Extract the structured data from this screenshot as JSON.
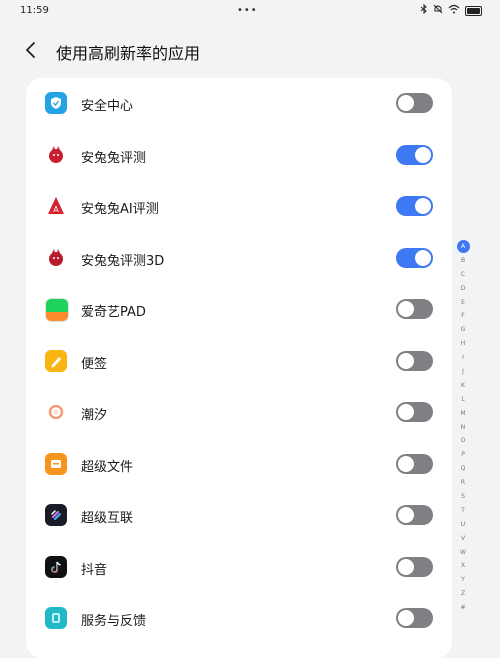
{
  "status_bar": {
    "time": "11:59",
    "dots": "•••"
  },
  "header": {
    "title": "使用高刷新率的应用"
  },
  "colors": {
    "accent": "#3f78f3",
    "toggle_off": "#7f8084",
    "card": "#ffffff",
    "background": "#f2f3f5"
  },
  "apps": [
    {
      "label": "安全中心",
      "icon": "security-center-icon",
      "enabled": false
    },
    {
      "label": "安兔兔评测",
      "icon": "antutu-icon",
      "enabled": true
    },
    {
      "label": "安兔兔AI评测",
      "icon": "antutu-ai-icon",
      "enabled": true
    },
    {
      "label": "安兔兔评测3D",
      "icon": "antutu-3d-icon",
      "enabled": true
    },
    {
      "label": "爱奇艺PAD",
      "icon": "iqiyi-icon",
      "enabled": false
    },
    {
      "label": "便签",
      "icon": "notes-icon",
      "enabled": false
    },
    {
      "label": "潮汐",
      "icon": "tide-icon",
      "enabled": false
    },
    {
      "label": "超级文件",
      "icon": "super-files-icon",
      "enabled": false
    },
    {
      "label": "超级互联",
      "icon": "super-link-icon",
      "enabled": false
    },
    {
      "label": "抖音",
      "icon": "douyin-icon",
      "enabled": false
    },
    {
      "label": "服务与反馈",
      "icon": "service-feedback-icon",
      "enabled": false
    }
  ],
  "alphabet": [
    "A",
    "B",
    "C",
    "D",
    "E",
    "F",
    "G",
    "H",
    "I",
    "J",
    "K",
    "L",
    "M",
    "N",
    "O",
    "P",
    "Q",
    "R",
    "S",
    "T",
    "U",
    "V",
    "W",
    "X",
    "Y",
    "Z",
    "#"
  ],
  "alphabet_active": "A"
}
